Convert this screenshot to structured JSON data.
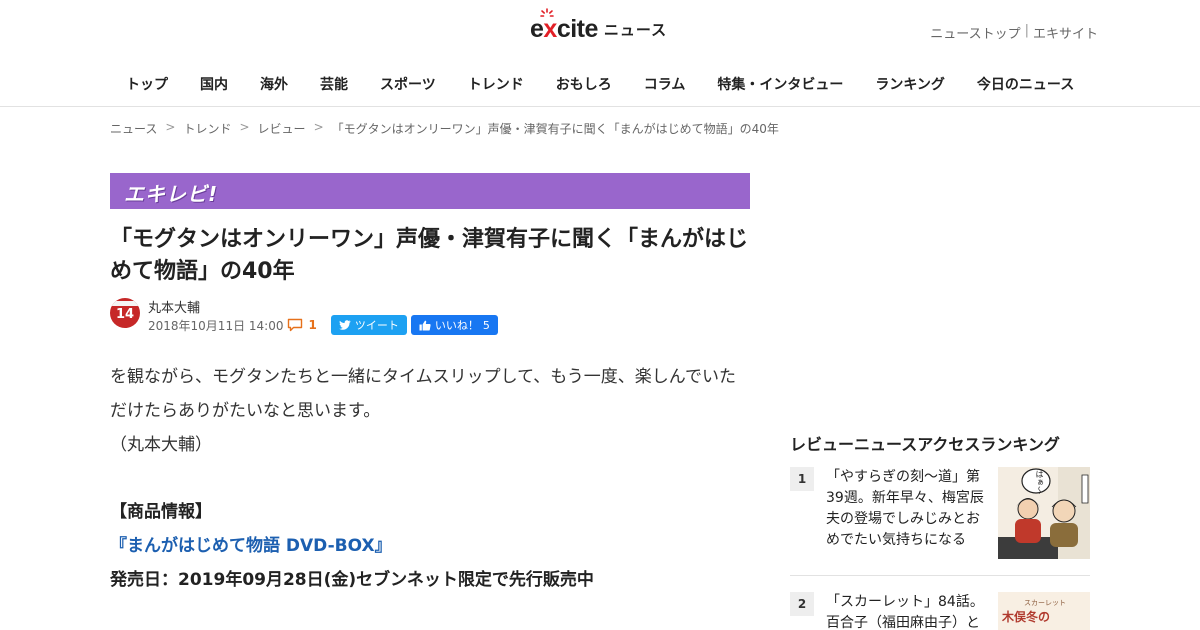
{
  "header": {
    "logo_text_pre": "e",
    "logo_text_x": "x",
    "logo_text_post": "cite",
    "logo_news": "ニュース",
    "top_links": [
      "ニューストップ",
      "エキサイト"
    ],
    "top_links_sep": "|",
    "nav": [
      "トップ",
      "国内",
      "海外",
      "芸能",
      "スポーツ",
      "トレンド",
      "おもしろ",
      "コラム",
      "特集・インタビュー",
      "ランキング",
      "今日のニュース"
    ]
  },
  "breadcrumb": {
    "items": [
      "ニュース",
      "トレンド",
      "レビュー",
      "「モグタンはオンリーワン」声優・津賀有子に聞く「まんがはじめて物語」の40年"
    ],
    "arrow": ">"
  },
  "banner": {
    "label": "エキレビ!"
  },
  "article": {
    "title": "「モグタンはオンリーワン」声優・津賀有子に聞く「まんがはじめて物語」の40年",
    "author": "丸本大輔",
    "avatar_number": "14",
    "date": "2018年10月11日 14:00",
    "comment_count": "1",
    "tweet_label": "ツイート",
    "like_label": "いいね！",
    "like_count": "5",
    "body": [
      "を観ながら、モグタンたちと一緒にタイムスリップして、もう一度、楽しんでいただけたらありがたいなと思います。",
      "（丸本大輔）"
    ],
    "product_heading": "【商品情報】",
    "product_link": "『まんがはじめて物語 DVD-BOX』",
    "release": "発売日：2019年09月28日(金)セブンネット限定で先行販売中"
  },
  "sidebar": {
    "ranking_title": "レビューニュースアクセスランキング",
    "items": [
      {
        "rank": "1",
        "text": "「やすらぎの刻～道」第39週。新年早々、梅宮辰夫の登場でしみじみとおめでたい気持ちになる",
        "thumb_bubble": "はぁ〜"
      },
      {
        "rank": "2",
        "text": "「スカーレット」84話。百合子（福田麻由子）と",
        "thumb_caption": "スカーレット",
        "thumb_title": "木俣冬の"
      }
    ]
  },
  "colors": {
    "banner": "#9966cc",
    "link": "#1c5fb0",
    "accent": "#e21f26",
    "tweet": "#1da1f2",
    "like": "#1877f2"
  }
}
